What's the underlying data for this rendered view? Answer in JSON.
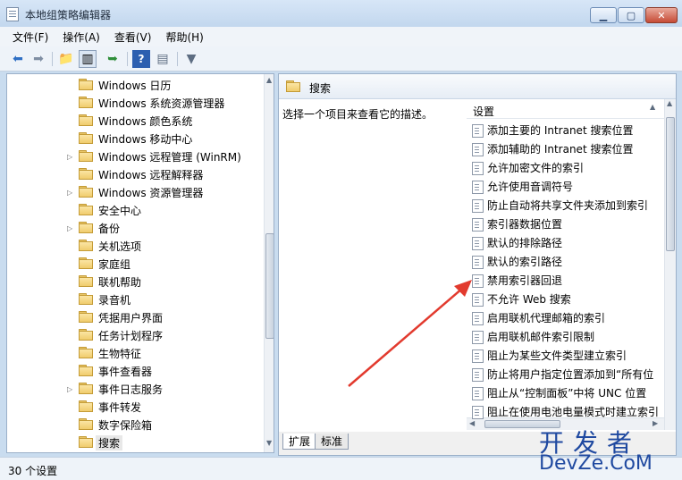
{
  "window": {
    "title": "本地组策略编辑器"
  },
  "menu": [
    {
      "label": "文件(F)"
    },
    {
      "label": "操作(A)"
    },
    {
      "label": "查看(V)"
    },
    {
      "label": "帮助(H)"
    }
  ],
  "tree": {
    "items": [
      {
        "label": "Windows 日历",
        "expandable": false
      },
      {
        "label": "Windows 系统资源管理器",
        "expandable": false
      },
      {
        "label": "Windows 颜色系统",
        "expandable": false
      },
      {
        "label": "Windows 移动中心",
        "expandable": false
      },
      {
        "label": "Windows 远程管理 (WinRM)",
        "expandable": true
      },
      {
        "label": "Windows 远程解释器",
        "expandable": false
      },
      {
        "label": "Windows 资源管理器",
        "expandable": true
      },
      {
        "label": "安全中心",
        "expandable": false
      },
      {
        "label": "备份",
        "expandable": true
      },
      {
        "label": "关机选项",
        "expandable": false
      },
      {
        "label": "家庭组",
        "expandable": false
      },
      {
        "label": "联机帮助",
        "expandable": false
      },
      {
        "label": "录音机",
        "expandable": false
      },
      {
        "label": "凭据用户界面",
        "expandable": false
      },
      {
        "label": "任务计划程序",
        "expandable": false
      },
      {
        "label": "生物特征",
        "expandable": false
      },
      {
        "label": "事件查看器",
        "expandable": false
      },
      {
        "label": "事件日志服务",
        "expandable": true
      },
      {
        "label": "事件转发",
        "expandable": false
      },
      {
        "label": "数字保险箱",
        "expandable": false
      },
      {
        "label": "搜索",
        "expandable": false,
        "selected": true
      }
    ]
  },
  "right": {
    "title": "搜索",
    "description": "选择一个项目来查看它的描述。",
    "column_header": "设置",
    "settings": [
      {
        "label": "添加主要的 Intranet 搜索位置"
      },
      {
        "label": "添加辅助的 Intranet 搜索位置"
      },
      {
        "label": "允许加密文件的索引"
      },
      {
        "label": "允许使用音调符号"
      },
      {
        "label": "防止自动将共享文件夹添加到索引"
      },
      {
        "label": "索引器数据位置"
      },
      {
        "label": "默认的排除路径"
      },
      {
        "label": "默认的索引路径"
      },
      {
        "label": "禁用索引器回退"
      },
      {
        "label": "不允许 Web 搜索"
      },
      {
        "label": "启用联机代理邮箱的索引"
      },
      {
        "label": "启用联机邮件索引限制"
      },
      {
        "label": "阻止为某些文件类型建立索引"
      },
      {
        "label": "防止将用户指定位置添加到“所有位"
      },
      {
        "label": "阻止从“控制面板”中将 UNC 位置"
      },
      {
        "label": "阻止在使用电池电量模式时建立索引"
      }
    ],
    "tabs": [
      {
        "label": "扩展"
      },
      {
        "label": "标准"
      }
    ]
  },
  "status": {
    "text": "30 个设置"
  },
  "watermark": {
    "line1": "开发者",
    "line2": "DevZe.CoM"
  },
  "colors": {
    "arrow": "#e23a2e",
    "selection": "#e8e8e8",
    "watermark": "#1f49a0"
  }
}
